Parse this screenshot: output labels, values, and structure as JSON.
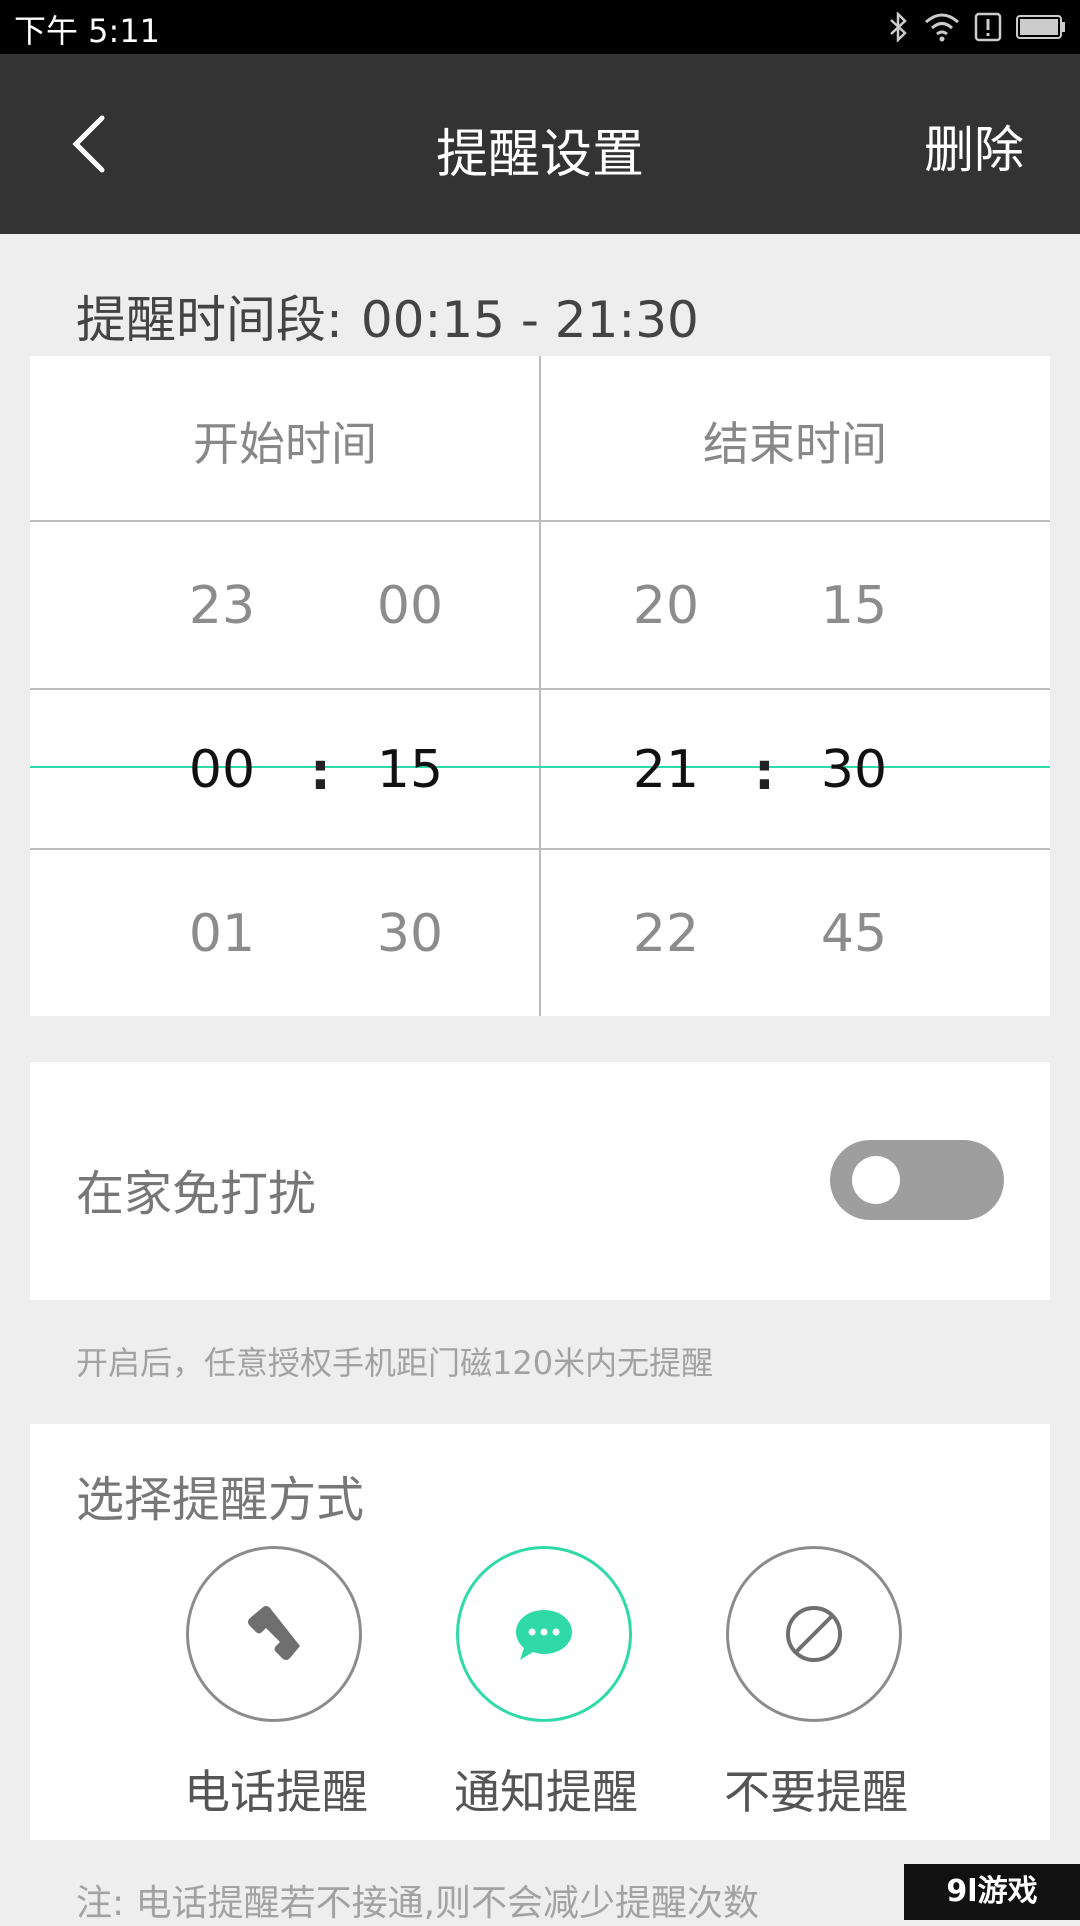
{
  "status_bar": {
    "time": "下午 5:11"
  },
  "header": {
    "title": "提醒设置",
    "delete_label": "删除"
  },
  "period": {
    "label": "提醒时间段:",
    "value": "00:15 - 21:30"
  },
  "time_picker": {
    "start": {
      "header": "开始时间",
      "hours_above": "23",
      "minutes_above": "00",
      "hours_selected": "00",
      "minutes_selected": "15",
      "hours_below": "01",
      "minutes_below": "30"
    },
    "end": {
      "header": "结束时间",
      "hours_above": "20",
      "minutes_above": "15",
      "hours_selected": "21",
      "minutes_selected": "30",
      "hours_below": "22",
      "minutes_below": "45"
    },
    "separator": ":"
  },
  "do_not_disturb": {
    "label": "在家免打扰",
    "enabled": false,
    "hint": "开启后，任意授权手机距门磁120米内无提醒"
  },
  "reminder_mode": {
    "title": "选择提醒方式",
    "options": [
      {
        "label": "电话提醒",
        "icon": "phone-icon",
        "selected": false
      },
      {
        "label": "通知提醒",
        "icon": "chat-bubble-icon",
        "selected": true
      },
      {
        "label": "不要提醒",
        "icon": "no-reminder-icon",
        "selected": false
      }
    ]
  },
  "footer_note": "注: 电话提醒若不接通,则不会减少提醒次数",
  "watermark": "9l游戏",
  "colors": {
    "accent": "#2fd9a8",
    "appbar": "#333333",
    "background": "#eeeeee"
  }
}
